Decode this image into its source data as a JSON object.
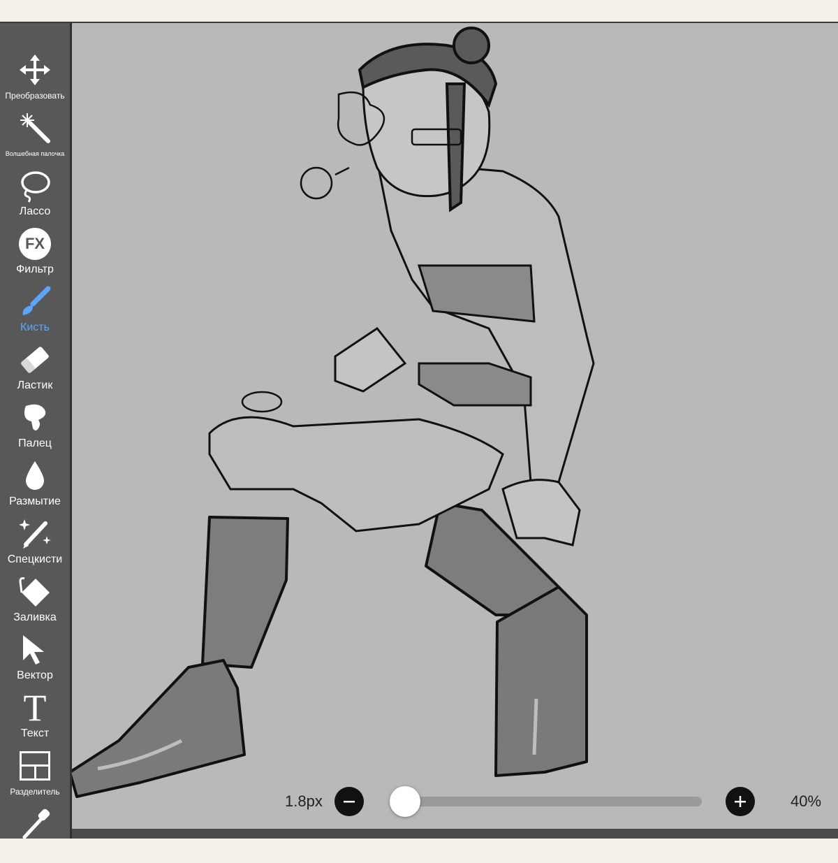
{
  "sidebar": {
    "tools": [
      {
        "label": "Преобразовать",
        "icon": "move-icon"
      },
      {
        "label": "Волшебная палочка",
        "icon": "magic-wand-icon"
      },
      {
        "label": "Лассо",
        "icon": "lasso-icon"
      },
      {
        "label": "Фильтр",
        "icon": "fx-filter-icon"
      },
      {
        "label": "Кисть",
        "icon": "brush-icon",
        "active": true
      },
      {
        "label": "Ластик",
        "icon": "eraser-icon"
      },
      {
        "label": "Палец",
        "icon": "smudge-finger-icon"
      },
      {
        "label": "Размытие",
        "icon": "blur-drop-icon"
      },
      {
        "label": "Спецкисти",
        "icon": "special-brush-icon"
      },
      {
        "label": "Заливка",
        "icon": "fill-bucket-icon"
      },
      {
        "label": "Вектор",
        "icon": "vector-cursor-icon"
      },
      {
        "label": "Текст",
        "icon": "text-icon"
      },
      {
        "label": "Разделитель",
        "icon": "frame-divider-icon"
      },
      {
        "label": "",
        "icon": "eyedropper-icon"
      }
    ],
    "fx_glyph": "FX",
    "text_glyph": "T"
  },
  "bottom_bar": {
    "brush_size": "1.8px",
    "opacity": "40%",
    "slider_value": 0.05
  },
  "colors": {
    "sidebar_bg": "#585858",
    "canvas_bg": "#b9b9b9",
    "active_tool": "#5aa6ff",
    "slider_fill": "#3557a8"
  }
}
